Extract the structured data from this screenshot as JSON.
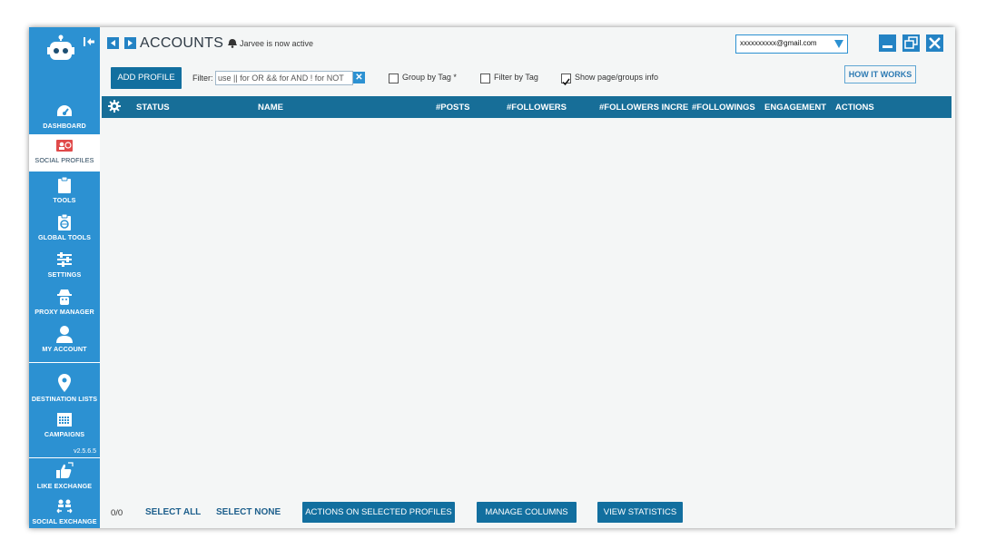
{
  "header": {
    "title": "ACCOUNTS",
    "status": "Jarvee is now active",
    "account_value": "xxxxxxxxxx@gmail.com"
  },
  "sidebar": {
    "items": [
      {
        "label": "DASHBOARD",
        "icon": "dashboard-icon"
      },
      {
        "label": "SOCIAL PROFILES",
        "icon": "social-profiles-icon"
      },
      {
        "label": "TOOLS",
        "icon": "clipboard-icon"
      },
      {
        "label": "GLOBAL TOOLS",
        "icon": "global-tools-icon"
      },
      {
        "label": "SETTINGS",
        "icon": "sliders-icon"
      },
      {
        "label": "PROXY MANAGER",
        "icon": "proxy-icon"
      },
      {
        "label": "MY ACCOUNT",
        "icon": "user-icon"
      },
      {
        "label": "DESTINATION LISTS",
        "icon": "map-pin-icon"
      },
      {
        "label": "CAMPAIGNS",
        "icon": "calendar-icon"
      },
      {
        "label": "LIKE EXCHANGE",
        "icon": "thumbs-up-icon"
      },
      {
        "label": "SOCIAL EXCHANGE",
        "icon": "people-exchange-icon"
      }
    ],
    "version": "v2.5.6.5"
  },
  "toolbar": {
    "add_profile": "ADD PROFILE",
    "filter_label": "Filter:",
    "filter_placeholder": "use || for OR && for AND ! for NOT",
    "group_by_tag": "Group by Tag *",
    "filter_by_tag": "Filter by Tag",
    "show_page_groups": "Show page/groups info",
    "how_it_works": "HOW IT WORKS"
  },
  "table": {
    "columns": [
      "STATUS",
      "NAME",
      "#POSTS",
      "#FOLLOWERS",
      "#FOLLOWERS INCREA",
      "#FOLLOWINGS",
      "ENGAGEMENT",
      "ACTIONS"
    ]
  },
  "footer": {
    "count": "0/0",
    "select_all": "SELECT ALL",
    "select_none": "SELECT NONE",
    "actions_selected": "ACTIONS ON SELECTED PROFILES",
    "manage_columns": "MANAGE COLUMNS",
    "view_statistics": "VIEW STATISTICS"
  },
  "colors": {
    "sidebar": "#2c91d2",
    "primary": "#126f9f",
    "table_header": "#176e98"
  }
}
